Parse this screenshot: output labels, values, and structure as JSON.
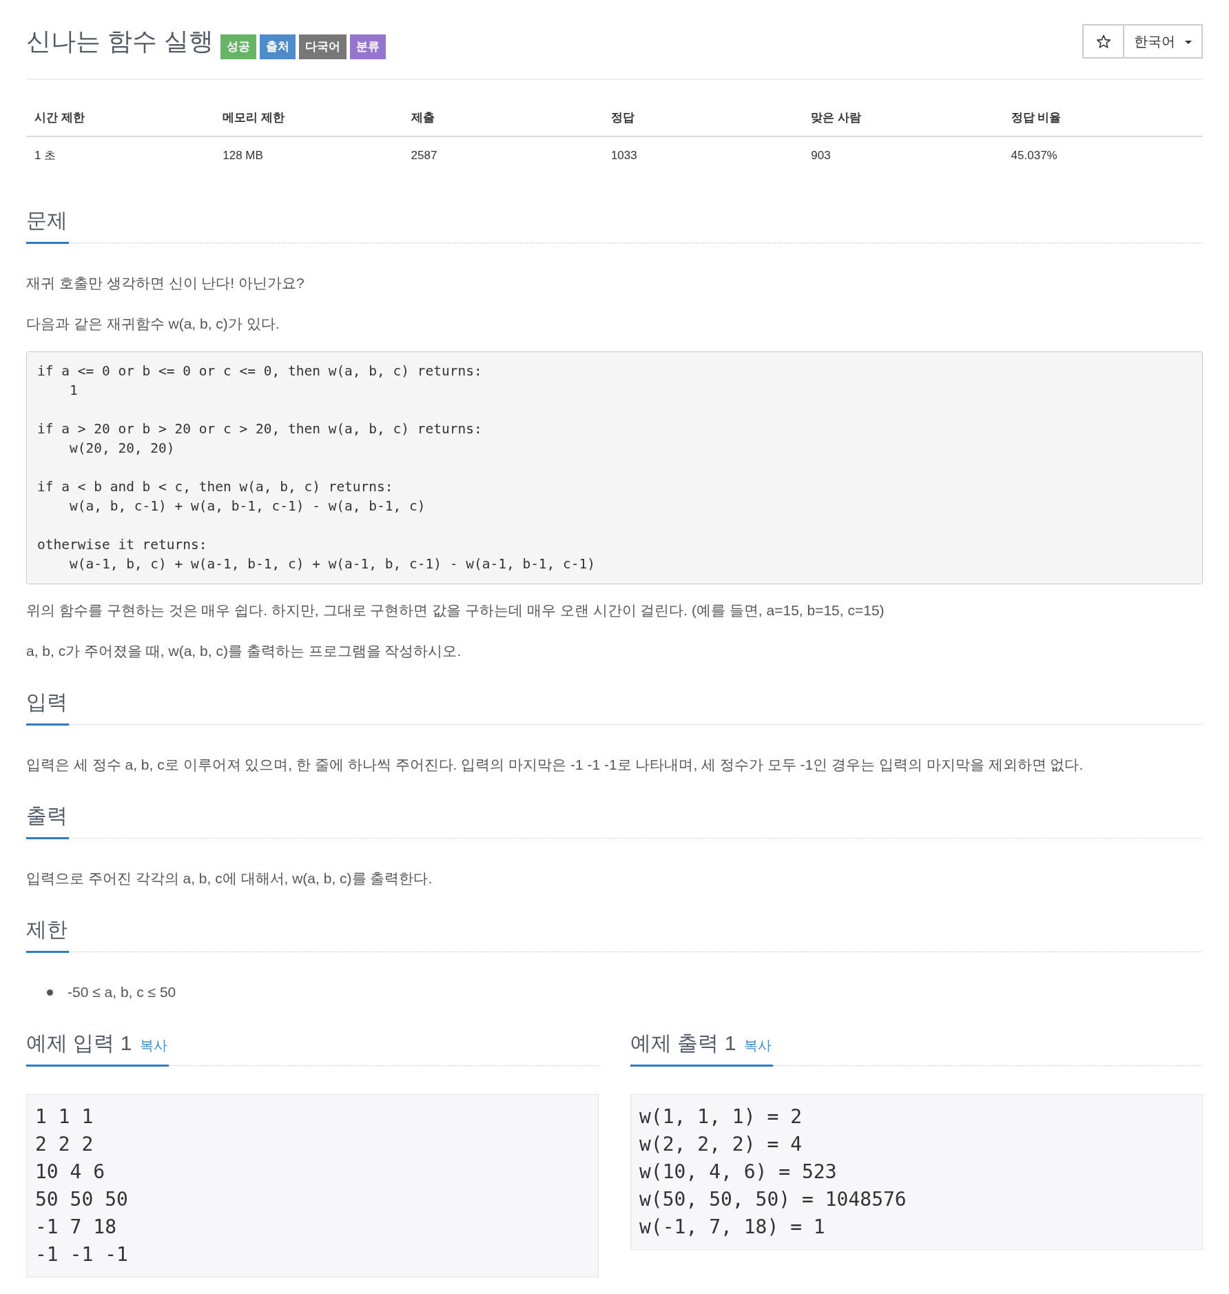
{
  "header": {
    "title": "신나는 함수 실행",
    "badges": [
      {
        "label": "성공",
        "color": "#67b467"
      },
      {
        "label": "출처",
        "color": "#4f8bc9"
      },
      {
        "label": "다국어",
        "color": "#777777"
      },
      {
        "label": "분류",
        "color": "#9575cd"
      }
    ],
    "language_dropdown": {
      "value": "한국어"
    }
  },
  "info_table": {
    "columns": [
      "시간 제한",
      "메모리 제한",
      "제출",
      "정답",
      "맞은 사람",
      "정답 비율"
    ],
    "rows": [
      [
        "1 초",
        "128 MB",
        "2587",
        "1033",
        "903",
        "45.037%"
      ]
    ]
  },
  "sections": [
    {
      "title": "문제",
      "blocks": [
        {
          "kind": "paragraph",
          "text": "재귀 호출만 생각하면 신이 난다! 아닌가요?"
        },
        {
          "kind": "paragraph",
          "text": "다음과 같은 재귀함수 w(a, b, c)가 있다."
        },
        {
          "kind": "code",
          "stanzas": [
            {
              "head": "if a <= 0 or b <= 0 or c <= 0, then w(a, b, c) returns:",
              "body": "1"
            },
            {
              "head": "if a > 20 or b > 20 or c > 20, then w(a, b, c) returns:",
              "body": "w(20, 20, 20)"
            },
            {
              "head": "if a < b and b < c, then w(a, b, c) returns:",
              "body": "w(a, b, c-1) + w(a, b-1, c-1) - w(a, b-1, c)"
            },
            {
              "head": "otherwise it returns:",
              "body": "w(a-1, b, c) + w(a-1, b-1, c) + w(a-1, b, c-1) - w(a-1, b-1, c-1)"
            }
          ]
        },
        {
          "kind": "paragraph",
          "text": "위의 함수를 구현하는 것은 매우 쉽다. 하지만, 그대로 구현하면 값을 구하는데 매우 오랜 시간이 걸린다. (예를 들면, a=15, b=15, c=15)"
        },
        {
          "kind": "paragraph",
          "text": "a, b, c가 주어졌을 때, w(a, b, c)를 출력하는 프로그램을 작성하시오."
        }
      ]
    },
    {
      "title": "입력",
      "blocks": [
        {
          "kind": "paragraph",
          "text": "입력은 세 정수 a, b, c로 이루어져 있으며, 한 줄에 하나씩 주어진다. 입력의 마지막은 -1 -1 -1로 나타내며, 세 정수가 모두 -1인 경우는 입력의 마지막을 제외하면 없다."
        }
      ]
    },
    {
      "title": "출력",
      "blocks": [
        {
          "kind": "paragraph",
          "text": "입력으로 주어진 각각의 a, b, c에 대해서, w(a, b, c)를 출력한다."
        }
      ]
    },
    {
      "title": "제한",
      "blocks": [
        {
          "kind": "list",
          "items": [
            "-50 ≤ a, b, c ≤ 50"
          ]
        }
      ]
    }
  ],
  "samples": [
    {
      "title": "예제 입력 1",
      "copy_link": "복사",
      "lines": [
        "1 1 1",
        "2 2 2",
        "10 4 6",
        "50 50 50",
        "-1 7 18",
        "-1 -1 -1"
      ]
    },
    {
      "title": "예제 출력 1",
      "copy_link": "복사",
      "lines": [
        "w(1, 1, 1) = 2",
        "w(2, 2, 2) = 4",
        "w(10, 4, 6) = 523",
        "w(50, 50, 50) = 1048576",
        "w(-1, 7, 18) = 1"
      ]
    }
  ]
}
